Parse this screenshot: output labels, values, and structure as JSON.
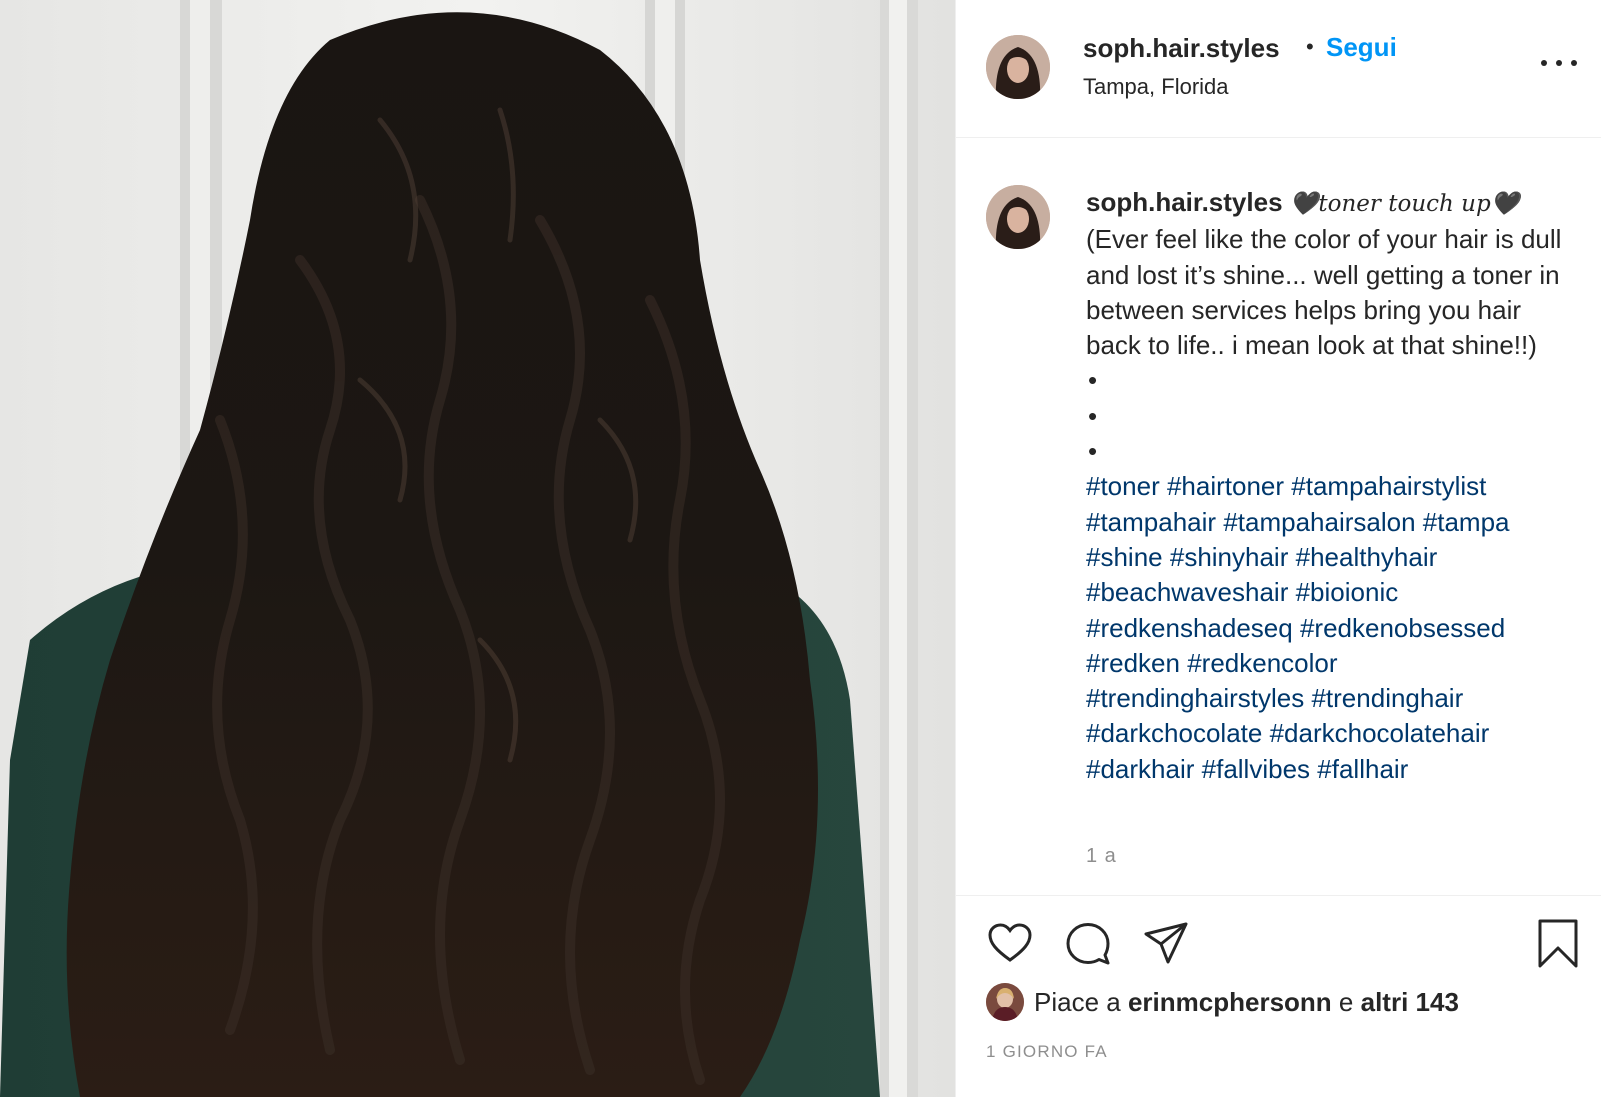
{
  "header": {
    "username": "soph.hair.styles",
    "separator": "•",
    "follow_label": "Segui",
    "location": "Tampa, Florida"
  },
  "caption": {
    "username": "soph.hair.styles",
    "title": "🖤toner touch up🖤",
    "text": "(Ever feel like the color of your hair is dull and lost it’s shine... well getting a toner in between services helps bring you hair back to life.. i mean look at that shine!!)",
    "bullets": [
      "•",
      "•",
      "•"
    ],
    "hashtags": [
      "#toner",
      "#hairtoner",
      "#tampahairstylist",
      "#tampahair",
      "#tampahairsalon",
      "#tampa",
      "#shine",
      "#shinyhair",
      "#healthyhair",
      "#beachwaveshair",
      "#bioionic",
      "#redkenshadeseq",
      "#redkenobsessed",
      "#redken",
      "#redkencolor",
      "#trendinghairstyles",
      "#trendinghair",
      "#darkchocolate",
      "#darkchocolatehair",
      "#darkhair",
      "#fallvibes",
      "#fallhair"
    ],
    "time": "1 a"
  },
  "likes": {
    "prefix": "Piace a",
    "user": "erinmcphersonn",
    "joiner": "e",
    "others": "altri 143"
  },
  "post_age": "1 GIORNO FA",
  "icons": {
    "like": "heart-icon",
    "comment": "comment-icon",
    "share": "paper-plane-icon",
    "save": "bookmark-icon",
    "more": "more-dots-icon"
  },
  "colors": {
    "link_blue": "#0095f6",
    "hashtag_blue": "#00376b",
    "muted": "#8e8e8e"
  }
}
